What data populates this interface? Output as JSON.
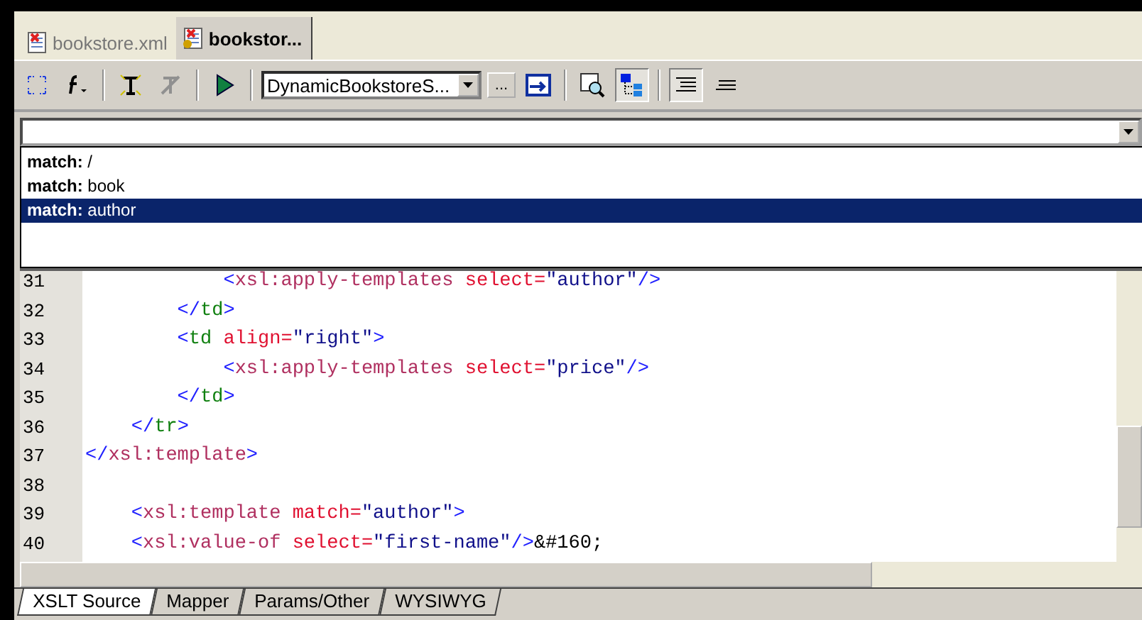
{
  "doc_tabs": [
    {
      "label": "bookstore.xml",
      "selected": false
    },
    {
      "label": "bookstor...",
      "selected": true
    }
  ],
  "toolbar": {
    "stylesheet_combo": {
      "value": "DynamicBookstoreS..."
    },
    "browse_button": "..."
  },
  "template_list": [
    {
      "label": "**match:** /",
      "selected": false
    },
    {
      "label": "**match:** book",
      "selected": false
    },
    {
      "label": "**match:** author",
      "selected": true
    }
  ],
  "editor": {
    "lines": [
      {
        "number": "31",
        "tokens": [
          {
            "kind": "punct",
            "text": "            <"
          },
          {
            "kind": "xsl",
            "text": "xsl:apply-templates"
          },
          {
            "kind": "attr",
            "text": " select="
          },
          {
            "kind": "value",
            "text": "\"author\""
          },
          {
            "kind": "punct",
            "text": "/>"
          }
        ]
      },
      {
        "number": "32",
        "tokens": [
          {
            "kind": "punct",
            "text": "        </"
          },
          {
            "kind": "html",
            "text": "td"
          },
          {
            "kind": "punct",
            "text": ">"
          }
        ]
      },
      {
        "number": "33",
        "tokens": [
          {
            "kind": "punct",
            "text": "        <"
          },
          {
            "kind": "html",
            "text": "td"
          },
          {
            "kind": "attr",
            "text": " align="
          },
          {
            "kind": "value",
            "text": "\"right\""
          },
          {
            "kind": "punct",
            "text": ">"
          }
        ]
      },
      {
        "number": "34",
        "tokens": [
          {
            "kind": "punct",
            "text": "            <"
          },
          {
            "kind": "xsl",
            "text": "xsl:apply-templates"
          },
          {
            "kind": "attr",
            "text": " select="
          },
          {
            "kind": "value",
            "text": "\"price\""
          },
          {
            "kind": "punct",
            "text": "/>"
          }
        ]
      },
      {
        "number": "35",
        "tokens": [
          {
            "kind": "punct",
            "text": "        </"
          },
          {
            "kind": "html",
            "text": "td"
          },
          {
            "kind": "punct",
            "text": ">"
          }
        ]
      },
      {
        "number": "36",
        "tokens": [
          {
            "kind": "punct",
            "text": "    </"
          },
          {
            "kind": "html",
            "text": "tr"
          },
          {
            "kind": "punct",
            "text": ">"
          }
        ]
      },
      {
        "number": "37",
        "tokens": [
          {
            "kind": "punct",
            "text": "</"
          },
          {
            "kind": "xsl",
            "text": "xsl:template"
          },
          {
            "kind": "punct",
            "text": ">"
          }
        ]
      },
      {
        "number": "38"
      },
      {
        "number": "39",
        "tokens": [
          {
            "kind": "punct",
            "text": "    <"
          },
          {
            "kind": "xsl",
            "text": "xsl:template"
          },
          {
            "kind": "attr",
            "text": " match="
          },
          {
            "kind": "value",
            "text": "\"author\""
          },
          {
            "kind": "punct",
            "text": ">"
          }
        ]
      },
      {
        "number": "40",
        "tokens": [
          {
            "kind": "punct",
            "text": "    <"
          },
          {
            "kind": "xsl",
            "text": "xsl:value-of"
          },
          {
            "kind": "attr",
            "text": " select="
          },
          {
            "kind": "value",
            "text": "\"first-name\""
          },
          {
            "kind": "punct",
            "text": "/>"
          },
          {
            "kind": "text",
            "text": "&#160;"
          }
        ]
      }
    ]
  },
  "view_tabs": [
    {
      "label": "XSLT Source",
      "selected": true
    },
    {
      "label": "Mapper",
      "selected": false
    },
    {
      "label": "Params/Other",
      "selected": false
    },
    {
      "label": "WYSIWYG",
      "selected": false
    }
  ]
}
